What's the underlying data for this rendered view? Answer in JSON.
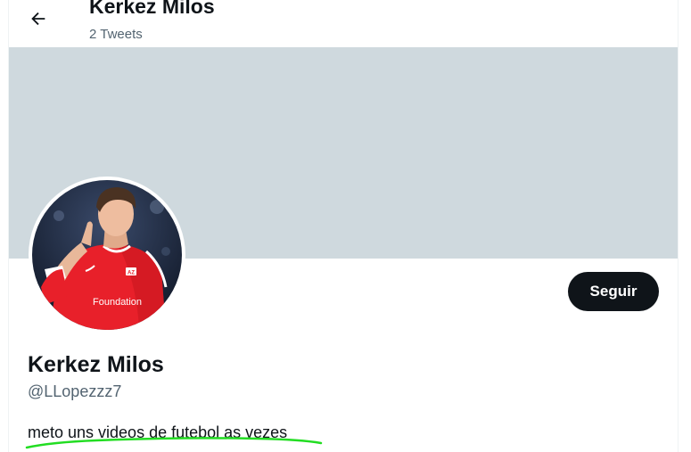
{
  "header": {
    "title": "Kerkez Milos",
    "subtitle": "2 Tweets",
    "back_icon": "arrow-left-icon"
  },
  "profile": {
    "display_name": "Kerkez Milos",
    "handle": "@LLopezzz7",
    "bio": "meto uns videos de futebol as vezes",
    "follow_label": "Seguir",
    "banner_color": "#cfd9de",
    "avatar": {
      "jersey_text": "Foundation",
      "jersey_color": "#e8202a",
      "club_badge": "AZ"
    }
  },
  "annotation": {
    "color": "#22dd22"
  }
}
